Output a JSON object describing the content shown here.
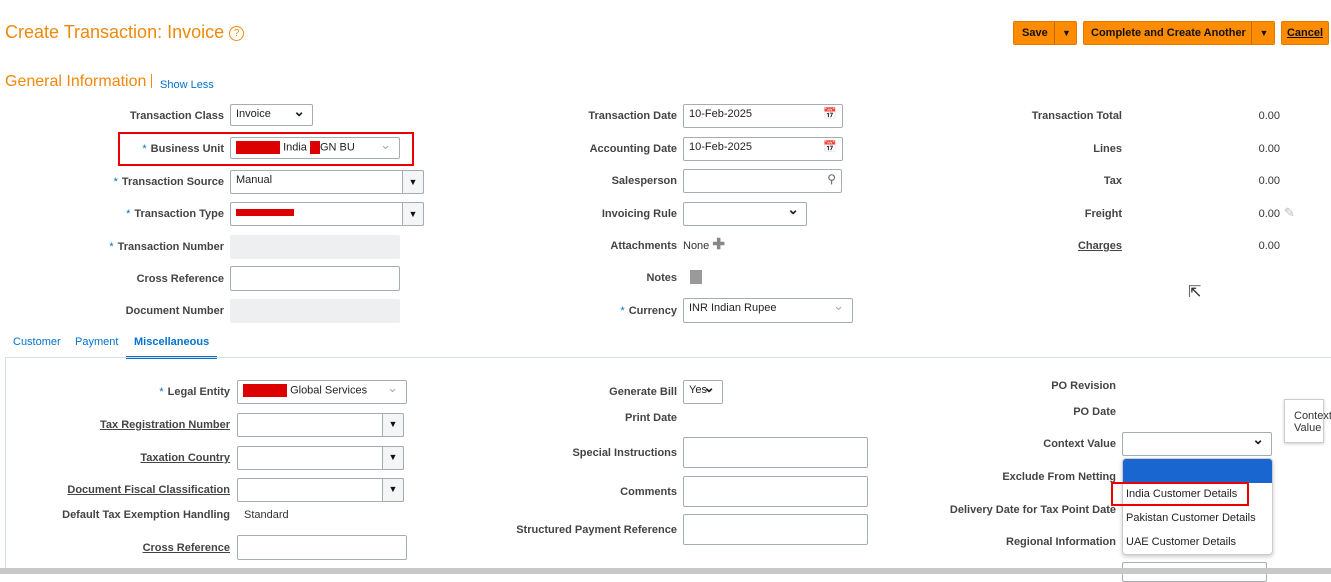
{
  "header": {
    "title": "Create Transaction: Invoice",
    "save": "Save",
    "complete": "Complete and Create Another",
    "cancel": "Cancel"
  },
  "section": {
    "title": "General Information",
    "show_less": "Show Less"
  },
  "left": {
    "transaction_class_label": "Transaction Class",
    "transaction_class": "Invoice",
    "business_unit_label": "Business Unit",
    "business_unit_a": "India",
    "business_unit_b": "GN BU",
    "transaction_source_label": "Transaction Source",
    "transaction_source": "Manual",
    "transaction_type_label": "Transaction Type",
    "transaction_number_label": "Transaction Number",
    "cross_reference_label": "Cross Reference",
    "document_number_label": "Document Number"
  },
  "middle": {
    "transaction_date_label": "Transaction Date",
    "transaction_date": "10-Feb-2025",
    "accounting_date_label": "Accounting Date",
    "accounting_date": "10-Feb-2025",
    "salesperson_label": "Salesperson",
    "invoicing_rule_label": "Invoicing Rule",
    "attachments_label": "Attachments",
    "attachments_value": "None",
    "notes_label": "Notes",
    "currency_label": "Currency",
    "currency": "INR Indian Rupee"
  },
  "totals": {
    "transaction_total_label": "Transaction Total",
    "transaction_total": "0.00",
    "lines_label": "Lines",
    "lines": "0.00",
    "tax_label": "Tax",
    "tax": "0.00",
    "freight_label": "Freight",
    "freight": "0.00",
    "charges_label": "Charges",
    "charges": "0.00"
  },
  "tabs": {
    "customer": "Customer",
    "payment": "Payment",
    "misc": "Miscellaneous"
  },
  "misc": {
    "legal_entity_label": "Legal Entity",
    "legal_entity": "Global Services",
    "tax_reg_label": "Tax Registration Number",
    "taxation_country_label": "Taxation Country",
    "doc_fiscal_label": "Document Fiscal Classification",
    "default_tax_label": "Default Tax Exemption Handling",
    "default_tax": "Standard",
    "cross_reference_label": "Cross Reference",
    "generate_bill_label": "Generate Bill",
    "generate_bill": "Yes",
    "print_date_label": "Print Date",
    "special_instructions_label": "Special Instructions",
    "comments_label": "Comments",
    "structured_payment_label": "Structured Payment Reference",
    "po_revision_label": "PO Revision",
    "po_date_label": "PO Date",
    "context_value_label": "Context Value",
    "exclude_netting_label": "Exclude From Netting",
    "delivery_date_label": "Delivery Date for Tax Point Date",
    "regional_info_label": "Regional Information",
    "tooltip": "Context Value",
    "options": [
      "India Customer Details",
      "Pakistan Customer Details",
      "UAE Customer Details"
    ]
  }
}
